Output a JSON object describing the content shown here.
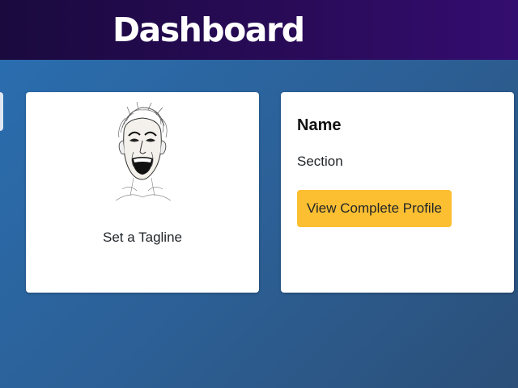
{
  "header": {
    "title": "Dashboard"
  },
  "profile_card": {
    "tagline": "Set a Tagline"
  },
  "info_card": {
    "name": "Name",
    "section": "Section",
    "button_label": "View Complete Profile"
  },
  "colors": {
    "header_bg": "#2a0b5a",
    "page_bg": "#2c5f95",
    "button_bg": "#fcbf31",
    "card_bg": "#ffffff"
  }
}
